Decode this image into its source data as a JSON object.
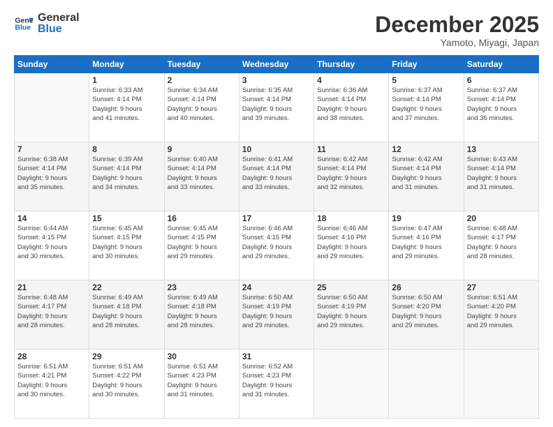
{
  "header": {
    "logo_line1": "General",
    "logo_line2": "Blue",
    "month_title": "December 2025",
    "subtitle": "Yamoto, Miyagi, Japan"
  },
  "days_of_week": [
    "Sunday",
    "Monday",
    "Tuesday",
    "Wednesday",
    "Thursday",
    "Friday",
    "Saturday"
  ],
  "weeks": [
    [
      {
        "day": "",
        "info": ""
      },
      {
        "day": "1",
        "info": "Sunrise: 6:33 AM\nSunset: 4:14 PM\nDaylight: 9 hours\nand 41 minutes."
      },
      {
        "day": "2",
        "info": "Sunrise: 6:34 AM\nSunset: 4:14 PM\nDaylight: 9 hours\nand 40 minutes."
      },
      {
        "day": "3",
        "info": "Sunrise: 6:35 AM\nSunset: 4:14 PM\nDaylight: 9 hours\nand 39 minutes."
      },
      {
        "day": "4",
        "info": "Sunrise: 6:36 AM\nSunset: 4:14 PM\nDaylight: 9 hours\nand 38 minutes."
      },
      {
        "day": "5",
        "info": "Sunrise: 6:37 AM\nSunset: 4:14 PM\nDaylight: 9 hours\nand 37 minutes."
      },
      {
        "day": "6",
        "info": "Sunrise: 6:37 AM\nSunset: 4:14 PM\nDaylight: 9 hours\nand 36 minutes."
      }
    ],
    [
      {
        "day": "7",
        "info": "Sunrise: 6:38 AM\nSunset: 4:14 PM\nDaylight: 9 hours\nand 35 minutes."
      },
      {
        "day": "8",
        "info": "Sunrise: 6:39 AM\nSunset: 4:14 PM\nDaylight: 9 hours\nand 34 minutes."
      },
      {
        "day": "9",
        "info": "Sunrise: 6:40 AM\nSunset: 4:14 PM\nDaylight: 9 hours\nand 33 minutes."
      },
      {
        "day": "10",
        "info": "Sunrise: 6:41 AM\nSunset: 4:14 PM\nDaylight: 9 hours\nand 33 minutes."
      },
      {
        "day": "11",
        "info": "Sunrise: 6:42 AM\nSunset: 4:14 PM\nDaylight: 9 hours\nand 32 minutes."
      },
      {
        "day": "12",
        "info": "Sunrise: 6:42 AM\nSunset: 4:14 PM\nDaylight: 9 hours\nand 31 minutes."
      },
      {
        "day": "13",
        "info": "Sunrise: 6:43 AM\nSunset: 4:14 PM\nDaylight: 9 hours\nand 31 minutes."
      }
    ],
    [
      {
        "day": "14",
        "info": "Sunrise: 6:44 AM\nSunset: 4:15 PM\nDaylight: 9 hours\nand 30 minutes."
      },
      {
        "day": "15",
        "info": "Sunrise: 6:45 AM\nSunset: 4:15 PM\nDaylight: 9 hours\nand 30 minutes."
      },
      {
        "day": "16",
        "info": "Sunrise: 6:45 AM\nSunset: 4:15 PM\nDaylight: 9 hours\nand 29 minutes."
      },
      {
        "day": "17",
        "info": "Sunrise: 6:46 AM\nSunset: 4:15 PM\nDaylight: 9 hours\nand 29 minutes."
      },
      {
        "day": "18",
        "info": "Sunrise: 6:46 AM\nSunset: 4:16 PM\nDaylight: 9 hours\nand 29 minutes."
      },
      {
        "day": "19",
        "info": "Sunrise: 6:47 AM\nSunset: 4:16 PM\nDaylight: 9 hours\nand 29 minutes."
      },
      {
        "day": "20",
        "info": "Sunrise: 6:48 AM\nSunset: 4:17 PM\nDaylight: 9 hours\nand 28 minutes."
      }
    ],
    [
      {
        "day": "21",
        "info": "Sunrise: 6:48 AM\nSunset: 4:17 PM\nDaylight: 9 hours\nand 28 minutes."
      },
      {
        "day": "22",
        "info": "Sunrise: 6:49 AM\nSunset: 4:18 PM\nDaylight: 9 hours\nand 28 minutes."
      },
      {
        "day": "23",
        "info": "Sunrise: 6:49 AM\nSunset: 4:18 PM\nDaylight: 9 hours\nand 28 minutes."
      },
      {
        "day": "24",
        "info": "Sunrise: 6:50 AM\nSunset: 4:19 PM\nDaylight: 9 hours\nand 29 minutes."
      },
      {
        "day": "25",
        "info": "Sunrise: 6:50 AM\nSunset: 4:19 PM\nDaylight: 9 hours\nand 29 minutes."
      },
      {
        "day": "26",
        "info": "Sunrise: 6:50 AM\nSunset: 4:20 PM\nDaylight: 9 hours\nand 29 minutes."
      },
      {
        "day": "27",
        "info": "Sunrise: 6:51 AM\nSunset: 4:20 PM\nDaylight: 9 hours\nand 29 minutes."
      }
    ],
    [
      {
        "day": "28",
        "info": "Sunrise: 6:51 AM\nSunset: 4:21 PM\nDaylight: 9 hours\nand 30 minutes."
      },
      {
        "day": "29",
        "info": "Sunrise: 6:51 AM\nSunset: 4:22 PM\nDaylight: 9 hours\nand 30 minutes."
      },
      {
        "day": "30",
        "info": "Sunrise: 6:51 AM\nSunset: 4:23 PM\nDaylight: 9 hours\nand 31 minutes."
      },
      {
        "day": "31",
        "info": "Sunrise: 6:52 AM\nSunset: 4:23 PM\nDaylight: 9 hours\nand 31 minutes."
      },
      {
        "day": "",
        "info": ""
      },
      {
        "day": "",
        "info": ""
      },
      {
        "day": "",
        "info": ""
      }
    ]
  ]
}
